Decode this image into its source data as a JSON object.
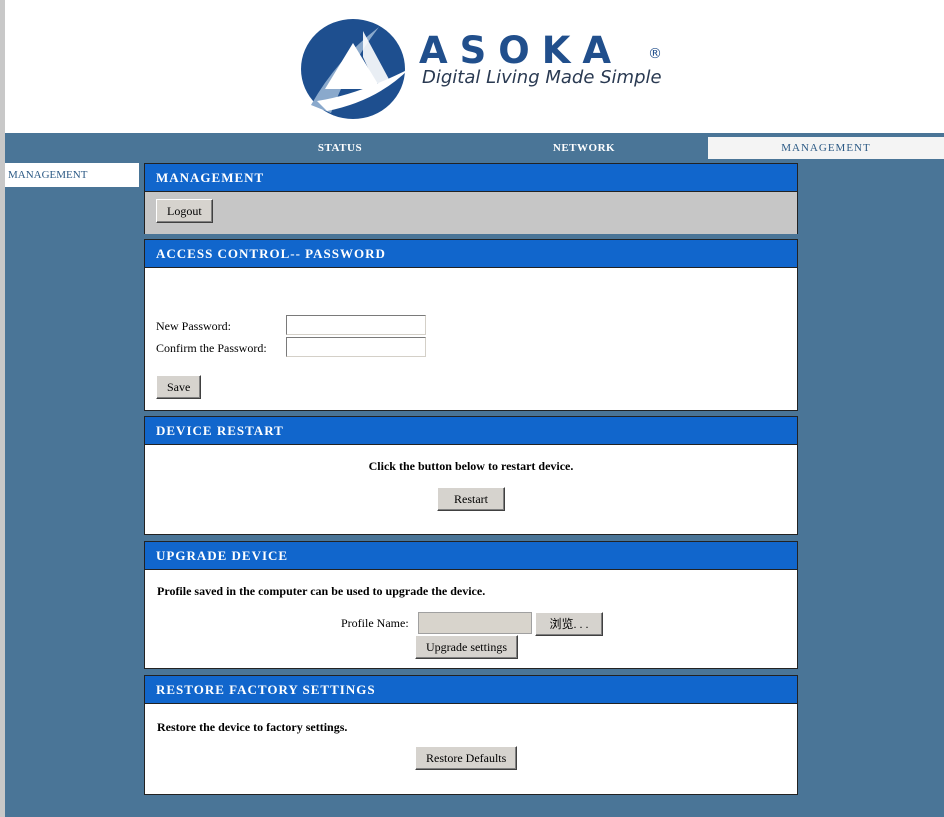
{
  "brand": {
    "name": "ASOKA",
    "registered": "®",
    "tagline": "Digital Living Made Simple",
    "color": "#214f8c"
  },
  "nav": {
    "tabs": [
      {
        "label": "STATUS",
        "active": false
      },
      {
        "label": "NETWORK",
        "active": false
      },
      {
        "label": "MANAGEMENT",
        "active": true
      }
    ]
  },
  "sidebar": {
    "items": [
      {
        "label": "MANAGEMENT",
        "active": true
      }
    ]
  },
  "management": {
    "title": "MANAGEMENT",
    "logout_label": "Logout"
  },
  "password": {
    "title": "ACCESS CONTROL-- PASSWORD",
    "new_label": "New Password:",
    "new_value": "",
    "confirm_label": "Confirm the Password:",
    "confirm_value": "",
    "save_label": "Save"
  },
  "restart": {
    "title": "DEVICE RESTART",
    "instruction": "Click the button below to restart device.",
    "button_label": "Restart"
  },
  "upgrade": {
    "title": "UPGRADE DEVICE",
    "description": "Profile saved in the computer can be used to upgrade the device.",
    "profile_label": "Profile Name:",
    "profile_value": "",
    "browse_label": "浏览. . .",
    "upgrade_label": "Upgrade settings"
  },
  "restore": {
    "title": "RESTORE FACTORY SETTINGS",
    "description": "Restore the device to factory settings.",
    "button_label": "Restore Defaults"
  },
  "colors": {
    "page_background": "#4a7597",
    "panel_header": "#1166cc",
    "button_face": "#d6d3ce"
  },
  "icons": {
    "logo": "asoka-triangle-logo"
  }
}
